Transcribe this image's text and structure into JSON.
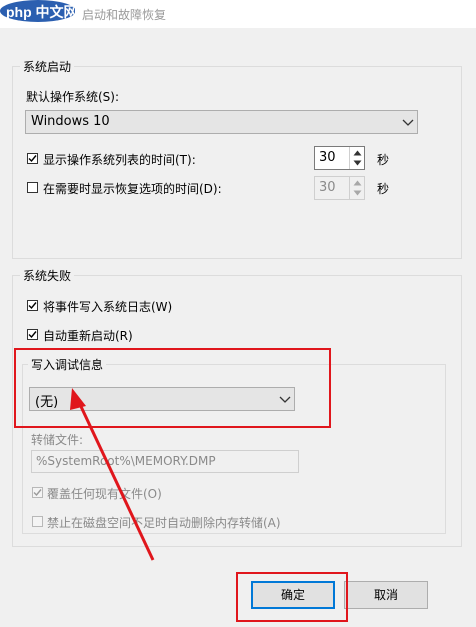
{
  "window": {
    "logo_text": "php 中文网",
    "title": "启动和故障恢复"
  },
  "startup": {
    "group_label": "系统启动",
    "default_os_label": "默认操作系统(S):",
    "default_os_value": "Windows 10",
    "show_os_list_label": "显示操作系统列表的时间(T):",
    "show_os_list_checked": true,
    "show_os_list_value": "30",
    "show_recovery_label": "在需要时显示恢复选项的时间(D):",
    "show_recovery_checked": false,
    "show_recovery_value": "30",
    "seconds_unit": "秒"
  },
  "failure": {
    "group_label": "系统失败",
    "write_event_label": "将事件写入系统日志(W)",
    "write_event_checked": true,
    "auto_restart_label": "自动重新启动(R)",
    "auto_restart_checked": true,
    "debug_group_label": "写入调试信息",
    "debug_value": "(无)",
    "dump_file_label": "转储文件:",
    "dump_file_value": "%SystemRoot%\\MEMORY.DMP",
    "overwrite_label": "覆盖任何现有文件(O)",
    "overwrite_checked": true,
    "disable_auto_delete_label": "禁止在磁盘空间不足时自动删除内存转储(A)",
    "disable_auto_delete_checked": false
  },
  "buttons": {
    "ok_label": "确定",
    "cancel_label": "取消"
  },
  "colors": {
    "annotation_red": "#e0161c",
    "logo_blue": "#2b5fb0"
  }
}
